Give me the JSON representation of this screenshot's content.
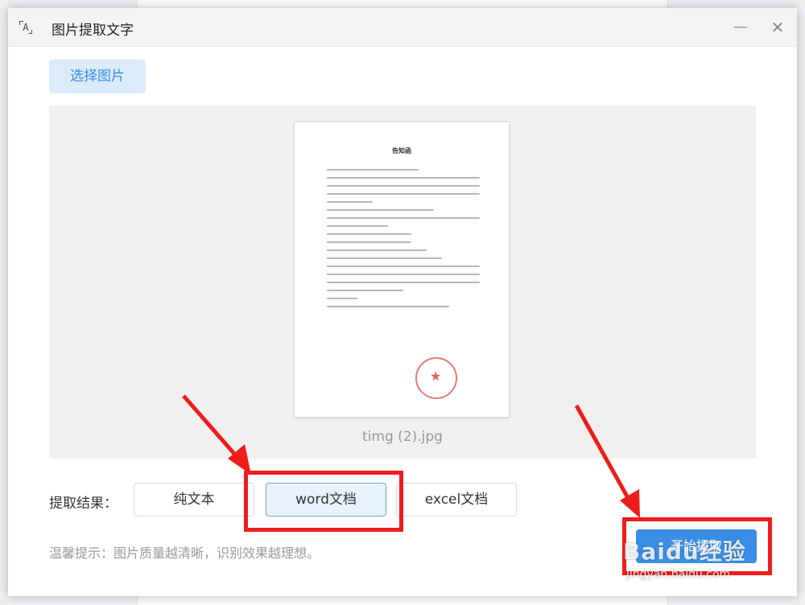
{
  "window": {
    "title": "图片提取文字",
    "minimize_icon": "minimize-icon",
    "close_icon": "close-icon",
    "minimize_glyph": "—",
    "close_glyph": "✕",
    "app_icon_glyph": "A"
  },
  "backdrop": {
    "title": "告知函"
  },
  "toolbar": {
    "select_label": "选择图片"
  },
  "preview": {
    "document_title": "告知函",
    "filename": "timg (2).jpg"
  },
  "result": {
    "label": "提取结果：",
    "options": [
      "纯文本",
      "word文档",
      "excel文档"
    ],
    "selected": "word文档"
  },
  "tip": "温馨提示：图片质量越清晰，识别效果越理想。",
  "start_label": "开始提取",
  "watermark": {
    "text": "Baidu经验",
    "url": "jingyan.baidu.com"
  },
  "colors": {
    "accent": "#3a8ee6",
    "highlight": "#ef1c1c",
    "selected_bg": "#e8f2fd"
  }
}
